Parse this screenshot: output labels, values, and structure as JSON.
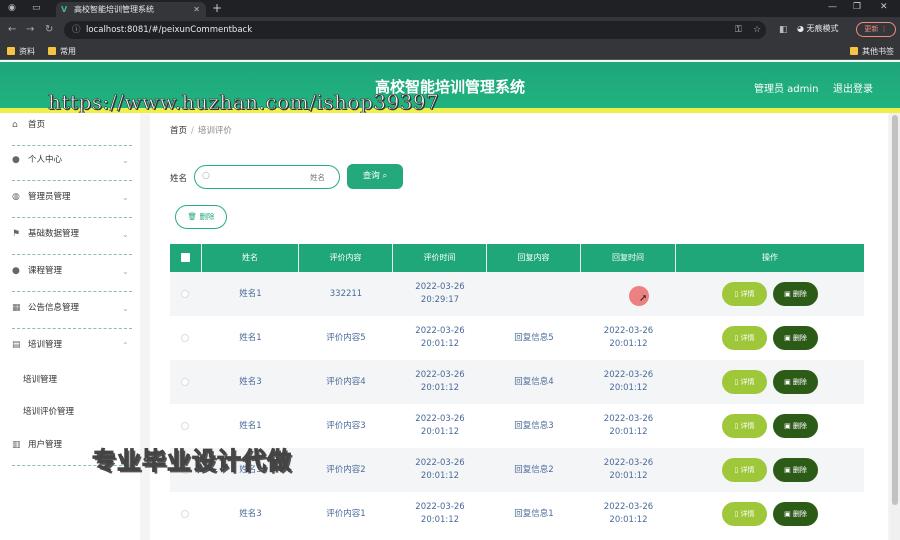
{
  "browser": {
    "tab_title": "高校智能培训管理系统",
    "tab_logo": "V",
    "url": "localhost:8081/#/peixunCommentback",
    "profile_label": "无痕模式",
    "update_label": "更新",
    "bookmarks": [
      "资料",
      "常用"
    ],
    "bookmarks_right": "其他书签"
  },
  "header": {
    "title": "高校智能培训管理系统",
    "user": "管理员 admin",
    "logout": "退出登录"
  },
  "watermarks": {
    "url": "https://www.huzhan.com/ishop39397",
    "text": "专业毕业设计代做"
  },
  "sidebar": {
    "items": [
      {
        "label": "首页",
        "icon": "home-icon",
        "chevron": false
      },
      {
        "label": "个人中心",
        "icon": "user-icon",
        "chevron": true
      },
      {
        "label": "管理员管理",
        "icon": "shield-icon",
        "chevron": true
      },
      {
        "label": "基础数据管理",
        "icon": "flag-icon",
        "chevron": true
      },
      {
        "label": "课程管理",
        "icon": "user-icon",
        "chevron": true
      },
      {
        "label": "公告信息管理",
        "icon": "grid-icon",
        "chevron": true
      },
      {
        "label": "培训管理",
        "icon": "chart-icon",
        "chevron": true
      },
      {
        "label": "用户管理",
        "icon": "table-icon",
        "chevron": true
      }
    ],
    "sub_items": [
      "培训管理",
      "培训评价管理"
    ]
  },
  "breadcrumb": {
    "home": "首页",
    "separator": "/",
    "current": "培训评价"
  },
  "search": {
    "label": "姓名",
    "placeholder": "姓名",
    "button": "查询"
  },
  "actions": {
    "delete": "删除"
  },
  "table": {
    "columns": [
      "姓名",
      "评价内容",
      "评价时间",
      "回复内容",
      "回复时间",
      "操作"
    ],
    "rows": [
      {
        "name": "姓名1",
        "content": "332211",
        "time": "2022-03-26 20:29:17",
        "reply": "",
        "reply_time": ""
      },
      {
        "name": "姓名1",
        "content": "评价内容5",
        "time": "2022-03-26 20:01:12",
        "reply": "回复信息5",
        "reply_time": "2022-03-26 20:01:12"
      },
      {
        "name": "姓名3",
        "content": "评价内容4",
        "time": "2022-03-26 20:01:12",
        "reply": "回复信息4",
        "reply_time": "2022-03-26 20:01:12"
      },
      {
        "name": "姓名1",
        "content": "评价内容3",
        "time": "2022-03-26 20:01:12",
        "reply": "回复信息3",
        "reply_time": "2022-03-26 20:01:12"
      },
      {
        "name": "姓名3",
        "content": "评价内容2",
        "time": "2022-03-26 20:01:12",
        "reply": "回复信息2",
        "reply_time": "2022-03-26 20:01:12"
      },
      {
        "name": "姓名3",
        "content": "评价内容1",
        "time": "2022-03-26 20:01:12",
        "reply": "回复信息1",
        "reply_time": "2022-03-26 20:01:12"
      }
    ],
    "row_actions": {
      "detail": "详情",
      "delete": "删除"
    }
  },
  "colors": {
    "header_green": "#20b37f",
    "table_header": "#1fa77a",
    "detail_btn": "#9ec73a",
    "delete_btn": "#2c5b18",
    "accent_yellow": "#eef04a"
  }
}
